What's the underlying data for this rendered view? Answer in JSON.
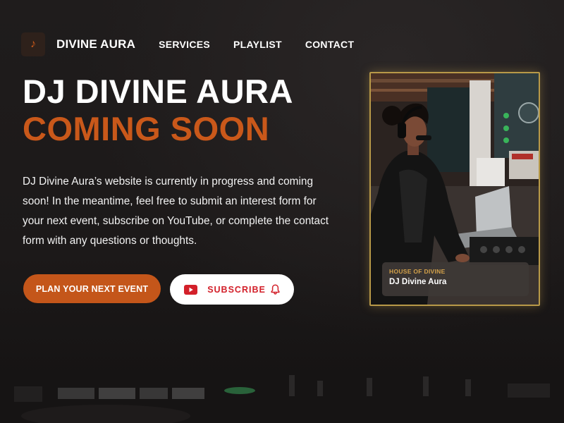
{
  "nav": {
    "logo_icon": "music-note-icon",
    "brand": "DIVINE AURA",
    "links": [
      "SERVICES",
      "PLAYLIST",
      "CONTACT"
    ]
  },
  "hero": {
    "title_line1": "DJ DIVINE AURA",
    "title_line2": "COMING SOON",
    "intro": "DJ Divine Aura’s website is currently in progress and coming soon! In the meantime, feel free to submit an interest form for your next event, subscribe on YouTube, or complete the contact form with any questions or thoughts.",
    "primary_button": "PLAN YOUR NEXT EVENT",
    "subscribe_button": "SUBSCRIBE"
  },
  "photo_card": {
    "caption_small": "HOUSE OF DIVINE",
    "caption_name": "DJ Divine Aura"
  },
  "colors": {
    "accent": "#c9581a",
    "background": "#1f1c1c",
    "youtube_red": "#d3202a",
    "gold_border": "#b89948"
  }
}
